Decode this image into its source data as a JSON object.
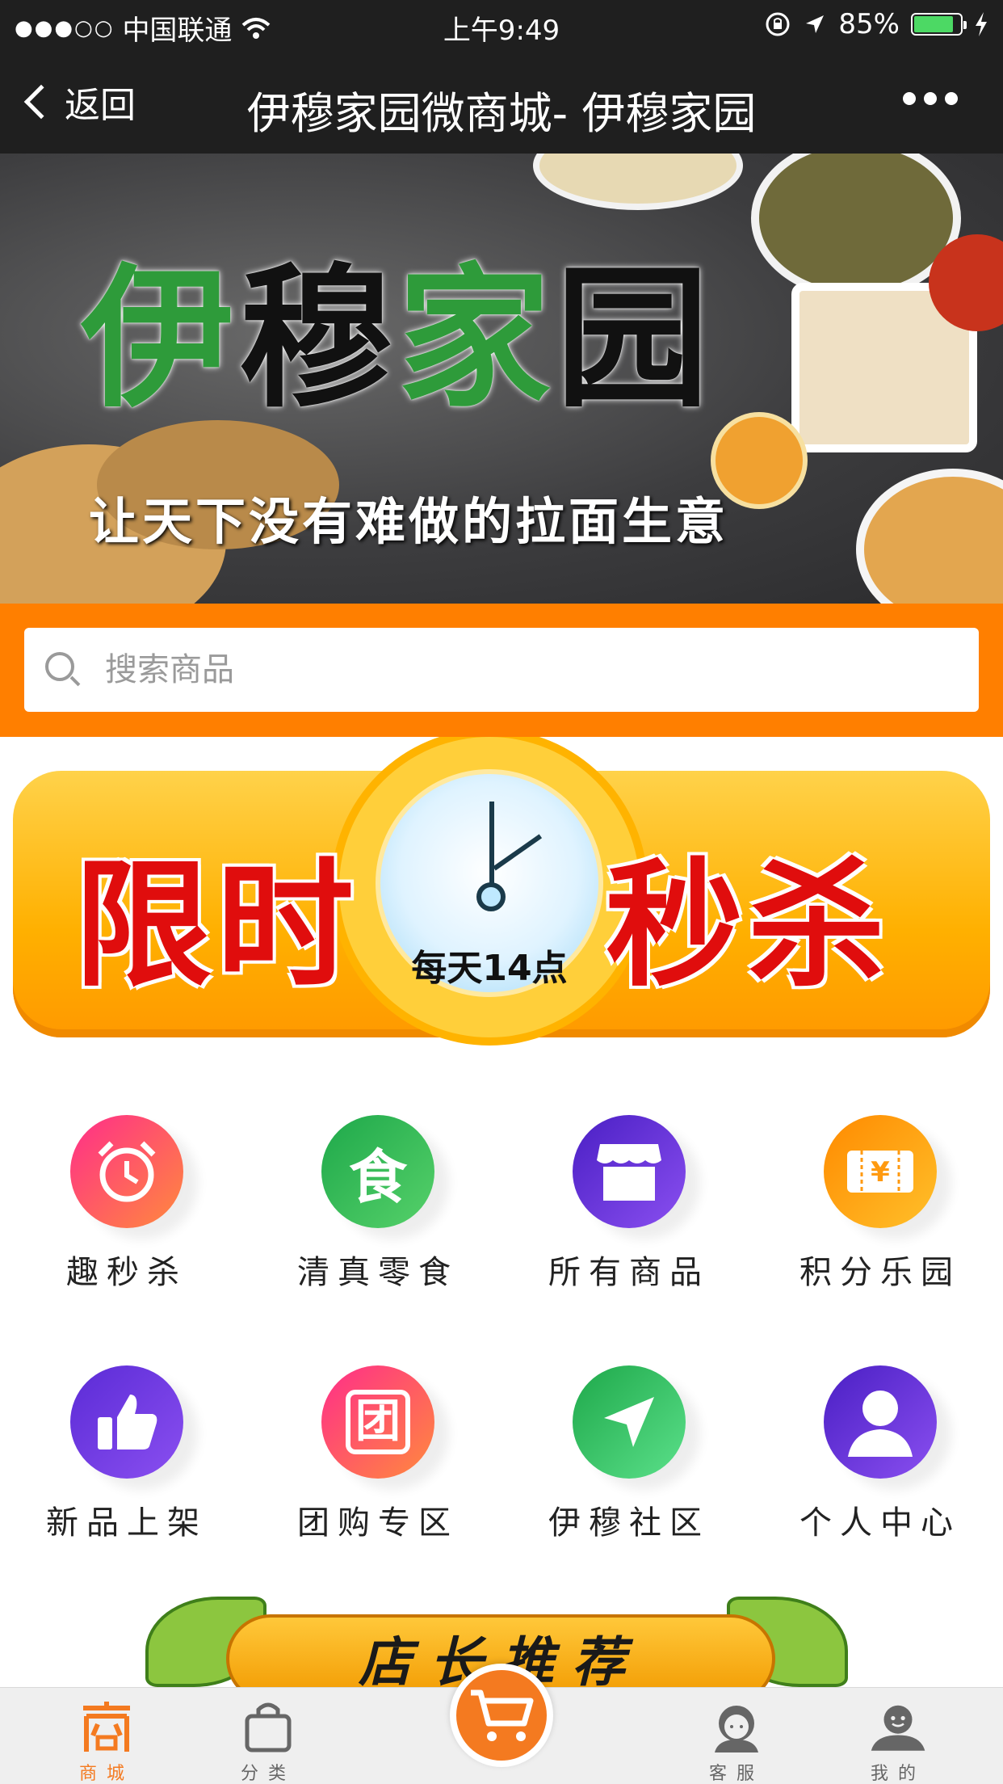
{
  "status_bar": {
    "signal": "●●●○○",
    "carrier": "中国联通",
    "time": "上午9:49",
    "battery": "85%"
  },
  "nav": {
    "back_label": "返回",
    "title": "伊穆家园微商城- 伊穆家园"
  },
  "banner": {
    "logo_part1": "伊",
    "logo_part2": "穆",
    "logo_part3": "家",
    "logo_part4": "园",
    "slogan": "让天下没有难做的拉面生意"
  },
  "search": {
    "placeholder": "搜索商品"
  },
  "flash_sale": {
    "left_text": "限时",
    "right_text": "秒杀",
    "schedule": "每天14点"
  },
  "shortcuts": [
    {
      "label": "趣秒杀",
      "icon": "alarm-clock-icon",
      "glyph": "⏰",
      "color1": "#ff2d8a",
      "color2": "#ff8a3d"
    },
    {
      "label": "清真零食",
      "icon": "food-icon",
      "glyph": "食",
      "color1": "#1ea84a",
      "color2": "#56d16a"
    },
    {
      "label": "所有商品",
      "icon": "store-icon",
      "glyph": "▤",
      "color1": "#5a2bd6",
      "color2": "#8a4ff0"
    },
    {
      "label": "积分乐园",
      "icon": "ticket-icon",
      "glyph": "¥",
      "color1": "#ff8a00",
      "color2": "#ffc02a"
    },
    {
      "label": "新品上架",
      "icon": "thumbs-up-icon",
      "glyph": "👍",
      "color1": "#5b2bd6",
      "color2": "#8a4ff0"
    },
    {
      "label": "团购专区",
      "icon": "group-buy-icon",
      "glyph": "团",
      "color1": "#ff2d8a",
      "color2": "#ff8a3d"
    },
    {
      "label": "伊穆社区",
      "icon": "paper-plane-icon",
      "glyph": "➤",
      "color1": "#1ea84a",
      "color2": "#5be08a"
    },
    {
      "label": "个人中心",
      "icon": "user-icon",
      "glyph": "●",
      "color1": "#4a1fc4",
      "color2": "#8a4ff0"
    }
  ],
  "recommend": {
    "title": "店长推荐"
  },
  "tabbar": {
    "tabs": [
      {
        "label": "商城",
        "icon": "shop-icon"
      },
      {
        "label": "分类",
        "icon": "bag-icon"
      },
      {
        "label": "",
        "icon": "cart-icon"
      },
      {
        "label": "客服",
        "icon": "service-icon"
      },
      {
        "label": "我的",
        "icon": "profile-icon"
      }
    ]
  },
  "colors": {
    "accent": "#ff7f00",
    "nav_bg": "#1f1f1f",
    "tab_active": "#f47a20"
  }
}
